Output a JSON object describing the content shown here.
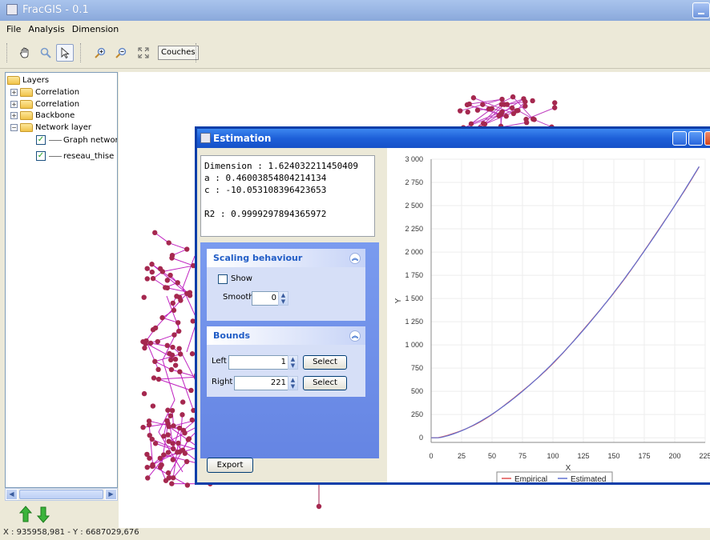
{
  "window": {
    "title": "FracGIS - 0.1"
  },
  "menu": [
    "File",
    "Analysis",
    "Dimension"
  ],
  "toolbar": {
    "couches_label": "Couches"
  },
  "layers": {
    "root": "Layers",
    "items": [
      {
        "label": "Correlation",
        "expander": "+"
      },
      {
        "label": "Correlation",
        "expander": "+"
      },
      {
        "label": "Backbone",
        "expander": "+"
      },
      {
        "label": "Network layer",
        "expander": "−"
      }
    ],
    "sublayers": [
      {
        "label": "Graph networ"
      },
      {
        "label": "reseau_thise"
      }
    ]
  },
  "status": {
    "coords": "X : 935958,981 - Y : 6687029,676"
  },
  "dialog": {
    "title": "Estimation",
    "stats": {
      "line1": "Dimension : 1.624032211450409",
      "line2": "a : 0.46003854804214134",
      "line3": "c : -10.053108396423653",
      "line4": "R2 : 0.9999297894365972"
    },
    "scaling": {
      "title": "Scaling behaviour",
      "show_label": "Show",
      "smooth_label": "Smooth",
      "smooth_value": "0"
    },
    "bounds": {
      "title": "Bounds",
      "left_label": "Left",
      "left_value": "1",
      "right_label": "Right",
      "right_value": "221",
      "select_label": "Select"
    },
    "export_label": "Export"
  },
  "chart_data": {
    "type": "line",
    "xlabel": "X",
    "ylabel": "Y",
    "xlim": [
      0,
      225
    ],
    "ylim": [
      -50,
      3000
    ],
    "x_ticks": [
      0,
      25,
      50,
      75,
      100,
      125,
      150,
      175,
      200,
      225
    ],
    "y_ticks": [
      0,
      250,
      500,
      750,
      "1 000",
      "1 250",
      "1 500",
      "1 750",
      "2 000",
      "2 250",
      "2 500",
      "2 750",
      "3 000"
    ],
    "series": [
      {
        "name": "Empirical",
        "color": "#e05050"
      },
      {
        "name": "Estimated",
        "color": "#6070d0"
      }
    ],
    "model": {
      "a": 0.46003854804214134,
      "dimension": 1.624032211450409,
      "c": -10.053108396423653
    },
    "x_range": [
      0,
      221
    ],
    "legend": "bottom"
  }
}
